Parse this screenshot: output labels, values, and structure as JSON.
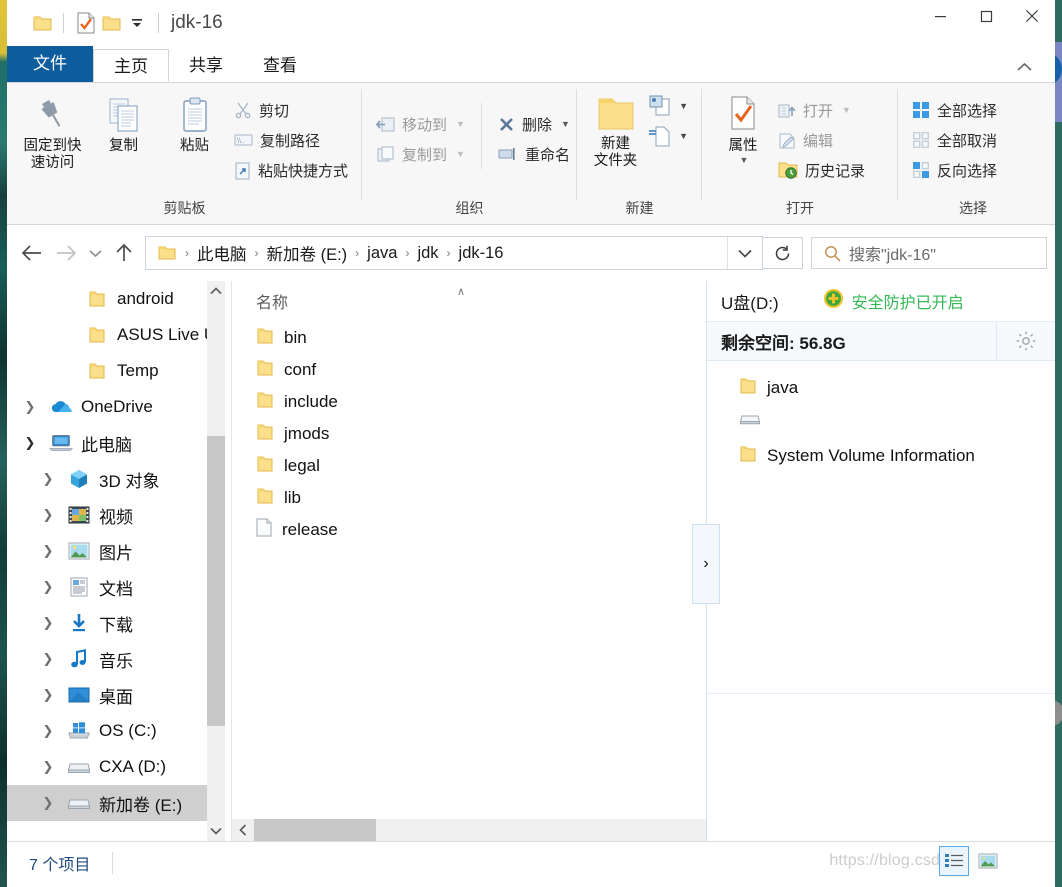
{
  "window": {
    "title": "jdk-16",
    "quick_access": [
      "folder-icon",
      "properties-icon",
      "new-folder-icon",
      "dropdown-icon"
    ],
    "controls": {
      "minimize": "—",
      "maximize": "☐",
      "close": "✕"
    }
  },
  "tabs": [
    {
      "label": "文件",
      "kind": "file"
    },
    {
      "label": "主页",
      "kind": "active"
    },
    {
      "label": "共享",
      "kind": "normal"
    },
    {
      "label": "查看",
      "kind": "normal"
    }
  ],
  "ribbon": {
    "groups": [
      {
        "label": "剪贴板",
        "big": [
          {
            "label": "固定到快\n速访问",
            "icon": "pin-icon"
          },
          {
            "label": "复制",
            "icon": "copy-icon"
          },
          {
            "label": "粘贴",
            "icon": "paste-icon"
          }
        ],
        "small": [
          {
            "label": "剪切",
            "icon": "scissors-icon",
            "disabled": true
          },
          {
            "label": "复制路径",
            "icon": "copy-path-icon",
            "disabled": true
          },
          {
            "label": "粘贴快捷方式",
            "icon": "paste-shortcut-icon",
            "disabled": true
          }
        ]
      },
      {
        "label": "组织",
        "small": [
          {
            "label": "移动到",
            "icon": "move-to-icon",
            "caret": true,
            "disabled": true
          },
          {
            "label": "复制到",
            "icon": "copy-to-icon",
            "caret": true,
            "disabled": true
          }
        ],
        "small2": [
          {
            "label": "删除",
            "icon": "delete-icon",
            "caret": true
          },
          {
            "label": "重命名",
            "icon": "rename-icon"
          }
        ]
      },
      {
        "label": "新建",
        "big": [
          {
            "label": "新建\n文件夹",
            "icon": "new-folder-icon"
          }
        ],
        "stack": [
          {
            "icon": "new-item-icon",
            "caret": true
          },
          {
            "icon": "easy-access-icon",
            "caret": true
          }
        ]
      },
      {
        "label": "打开",
        "big": [
          {
            "label": "属性",
            "icon": "properties-icon",
            "caret": true
          }
        ],
        "small": [
          {
            "label": "打开",
            "icon": "open-icon",
            "caret": true,
            "disabled": true
          },
          {
            "label": "编辑",
            "icon": "edit-icon",
            "disabled": true
          },
          {
            "label": "历史记录",
            "icon": "history-icon"
          }
        ]
      },
      {
        "label": "选择",
        "small": [
          {
            "label": "全部选择",
            "icon": "select-all-icon"
          },
          {
            "label": "全部取消",
            "icon": "select-none-icon"
          },
          {
            "label": "反向选择",
            "icon": "invert-selection-icon"
          }
        ]
      }
    ]
  },
  "address": {
    "back": "back-arrow-icon",
    "forward": "forward-arrow-icon",
    "recent": "recent-dropdown-icon",
    "up": "up-arrow-icon",
    "crumbs": [
      "此电脑",
      "新加卷 (E:)",
      "java",
      "jdk",
      "jdk-16"
    ],
    "separator": "›",
    "refresh": "refresh-icon",
    "search_placeholder": "搜索\"jdk-16\""
  },
  "nav_tree": [
    {
      "label": "android",
      "icon": "folder-icon",
      "indent": 3,
      "chevron": "none"
    },
    {
      "label": "ASUS Live Upda",
      "icon": "folder-icon",
      "indent": 3,
      "chevron": "none"
    },
    {
      "label": "Temp",
      "icon": "folder-icon",
      "indent": 3,
      "chevron": "none"
    },
    {
      "label": "OneDrive",
      "icon": "onedrive-icon",
      "indent": 1,
      "chevron": "closed"
    },
    {
      "label": "此电脑",
      "icon": "this-pc-icon",
      "indent": 1,
      "chevron": "open"
    },
    {
      "label": "3D 对象",
      "icon": "3d-objects-icon",
      "indent": 2,
      "chevron": "closed"
    },
    {
      "label": "视频",
      "icon": "videos-icon",
      "indent": 2,
      "chevron": "closed"
    },
    {
      "label": "图片",
      "icon": "pictures-icon",
      "indent": 2,
      "chevron": "closed"
    },
    {
      "label": "文档",
      "icon": "documents-icon",
      "indent": 2,
      "chevron": "closed"
    },
    {
      "label": "下载",
      "icon": "downloads-icon",
      "indent": 2,
      "chevron": "closed"
    },
    {
      "label": "音乐",
      "icon": "music-icon",
      "indent": 2,
      "chevron": "closed"
    },
    {
      "label": "桌面",
      "icon": "desktop-icon",
      "indent": 2,
      "chevron": "closed"
    },
    {
      "label": "OS (C:)",
      "icon": "windows-drive-icon",
      "indent": 2,
      "chevron": "closed"
    },
    {
      "label": "CXA (D:)",
      "icon": "drive-icon",
      "indent": 2,
      "chevron": "closed"
    },
    {
      "label": "新加卷 (E:)",
      "icon": "drive-icon",
      "indent": 2,
      "chevron": "closed",
      "selected": true
    }
  ],
  "file_list": {
    "column_header": "名称",
    "sort_indicator": "∧",
    "items": [
      {
        "name": "bin",
        "type": "folder"
      },
      {
        "name": "conf",
        "type": "folder"
      },
      {
        "name": "include",
        "type": "folder"
      },
      {
        "name": "jmods",
        "type": "folder"
      },
      {
        "name": "legal",
        "type": "folder"
      },
      {
        "name": "lib",
        "type": "folder"
      },
      {
        "name": "release",
        "type": "file"
      }
    ]
  },
  "usb_panel": {
    "drive": "U盘(D:)",
    "protection": "安全防护已开启",
    "protection_color": "#33b855",
    "free_space": "剩余空间: 56.8G",
    "gear": "gear-icon",
    "collapse": "›",
    "items": [
      {
        "name": "java",
        "type": "folder"
      },
      {
        "name": "",
        "type": "drive"
      },
      {
        "name": "System Volume Information",
        "type": "folder"
      }
    ]
  },
  "status": {
    "item_count": "7 个项目",
    "watermark": "https://blog.csdn.n",
    "views": [
      {
        "icon": "details-view-icon",
        "active": true
      },
      {
        "icon": "large-icons-view-icon",
        "active": false
      }
    ]
  }
}
